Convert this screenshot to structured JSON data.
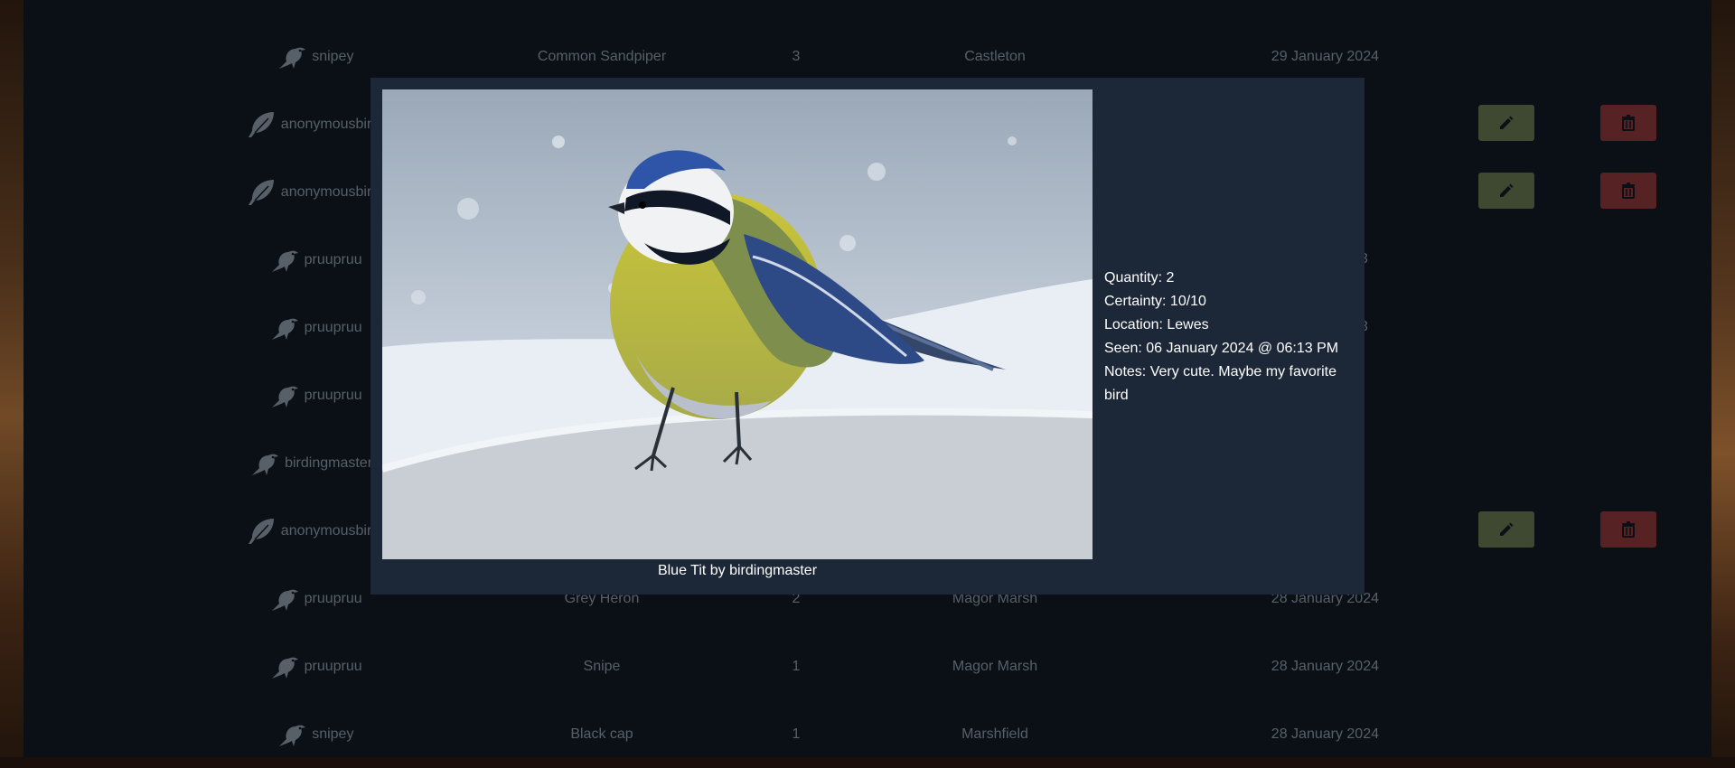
{
  "rows": [
    {
      "user": "snipey",
      "icon": "bird-icon",
      "species": "Common Sandpiper",
      "quantity": "3",
      "location": "Castleton",
      "date": "29 January 2024",
      "editable": false
    },
    {
      "user": "anonymousbirdy",
      "icon": "feather-icon",
      "species": "",
      "quantity": "",
      "location": "",
      "date": "",
      "editable": true
    },
    {
      "user": "anonymousbirdy",
      "icon": "feather-icon",
      "species": "",
      "quantity": "",
      "location": "",
      "date": "",
      "editable": true
    },
    {
      "user": "pruupruu",
      "icon": "bird-icon",
      "species": "",
      "quantity": "",
      "location": "",
      "date": "",
      "editable": false
    },
    {
      "user": "pruupruu",
      "icon": "bird-icon",
      "species": "",
      "quantity": "",
      "location": "",
      "date": "",
      "editable": false
    },
    {
      "user": "pruupruu",
      "icon": "bird-icon",
      "species": "",
      "quantity": "",
      "location": "",
      "date": "",
      "editable": false
    },
    {
      "user": "birdingmaster",
      "icon": "bird-icon",
      "species": "",
      "quantity": "",
      "location": "",
      "date": "",
      "editable": false
    },
    {
      "user": "anonymousbirdy",
      "icon": "feather-icon",
      "species": "",
      "quantity": "",
      "location": "",
      "date": "",
      "editable": true
    },
    {
      "user": "pruupruu",
      "icon": "bird-icon",
      "species": "Grey Heron",
      "quantity": "2",
      "location": "Magor Marsh",
      "date": "28 January 2024",
      "editable": false
    },
    {
      "user": "pruupruu",
      "icon": "bird-icon",
      "species": "Snipe",
      "quantity": "1",
      "location": "Magor Marsh",
      "date": "28 January 2024",
      "editable": false
    },
    {
      "user": "snipey",
      "icon": "bird-icon",
      "species": "Black cap",
      "quantity": "1",
      "location": "Marshfield",
      "date": "28 January 2024",
      "editable": false
    }
  ],
  "partial_dates": [
    "3",
    "3"
  ],
  "modal": {
    "caption": "Blue Tit by birdingmaster",
    "quantity": "Quantity: 2",
    "certainty": "Certainty: 10/10",
    "location": "Location: Lewes",
    "seen": "Seen: 06 January 2024 @ 06:13 PM",
    "notes": "Notes: Very cute. Maybe my favorite bird"
  },
  "colors": {
    "edit_button": "#4e5a3e",
    "delete_button": "#6b2a2c",
    "modal_bg": "#1c2737",
    "table_bg": "#0d141c"
  }
}
